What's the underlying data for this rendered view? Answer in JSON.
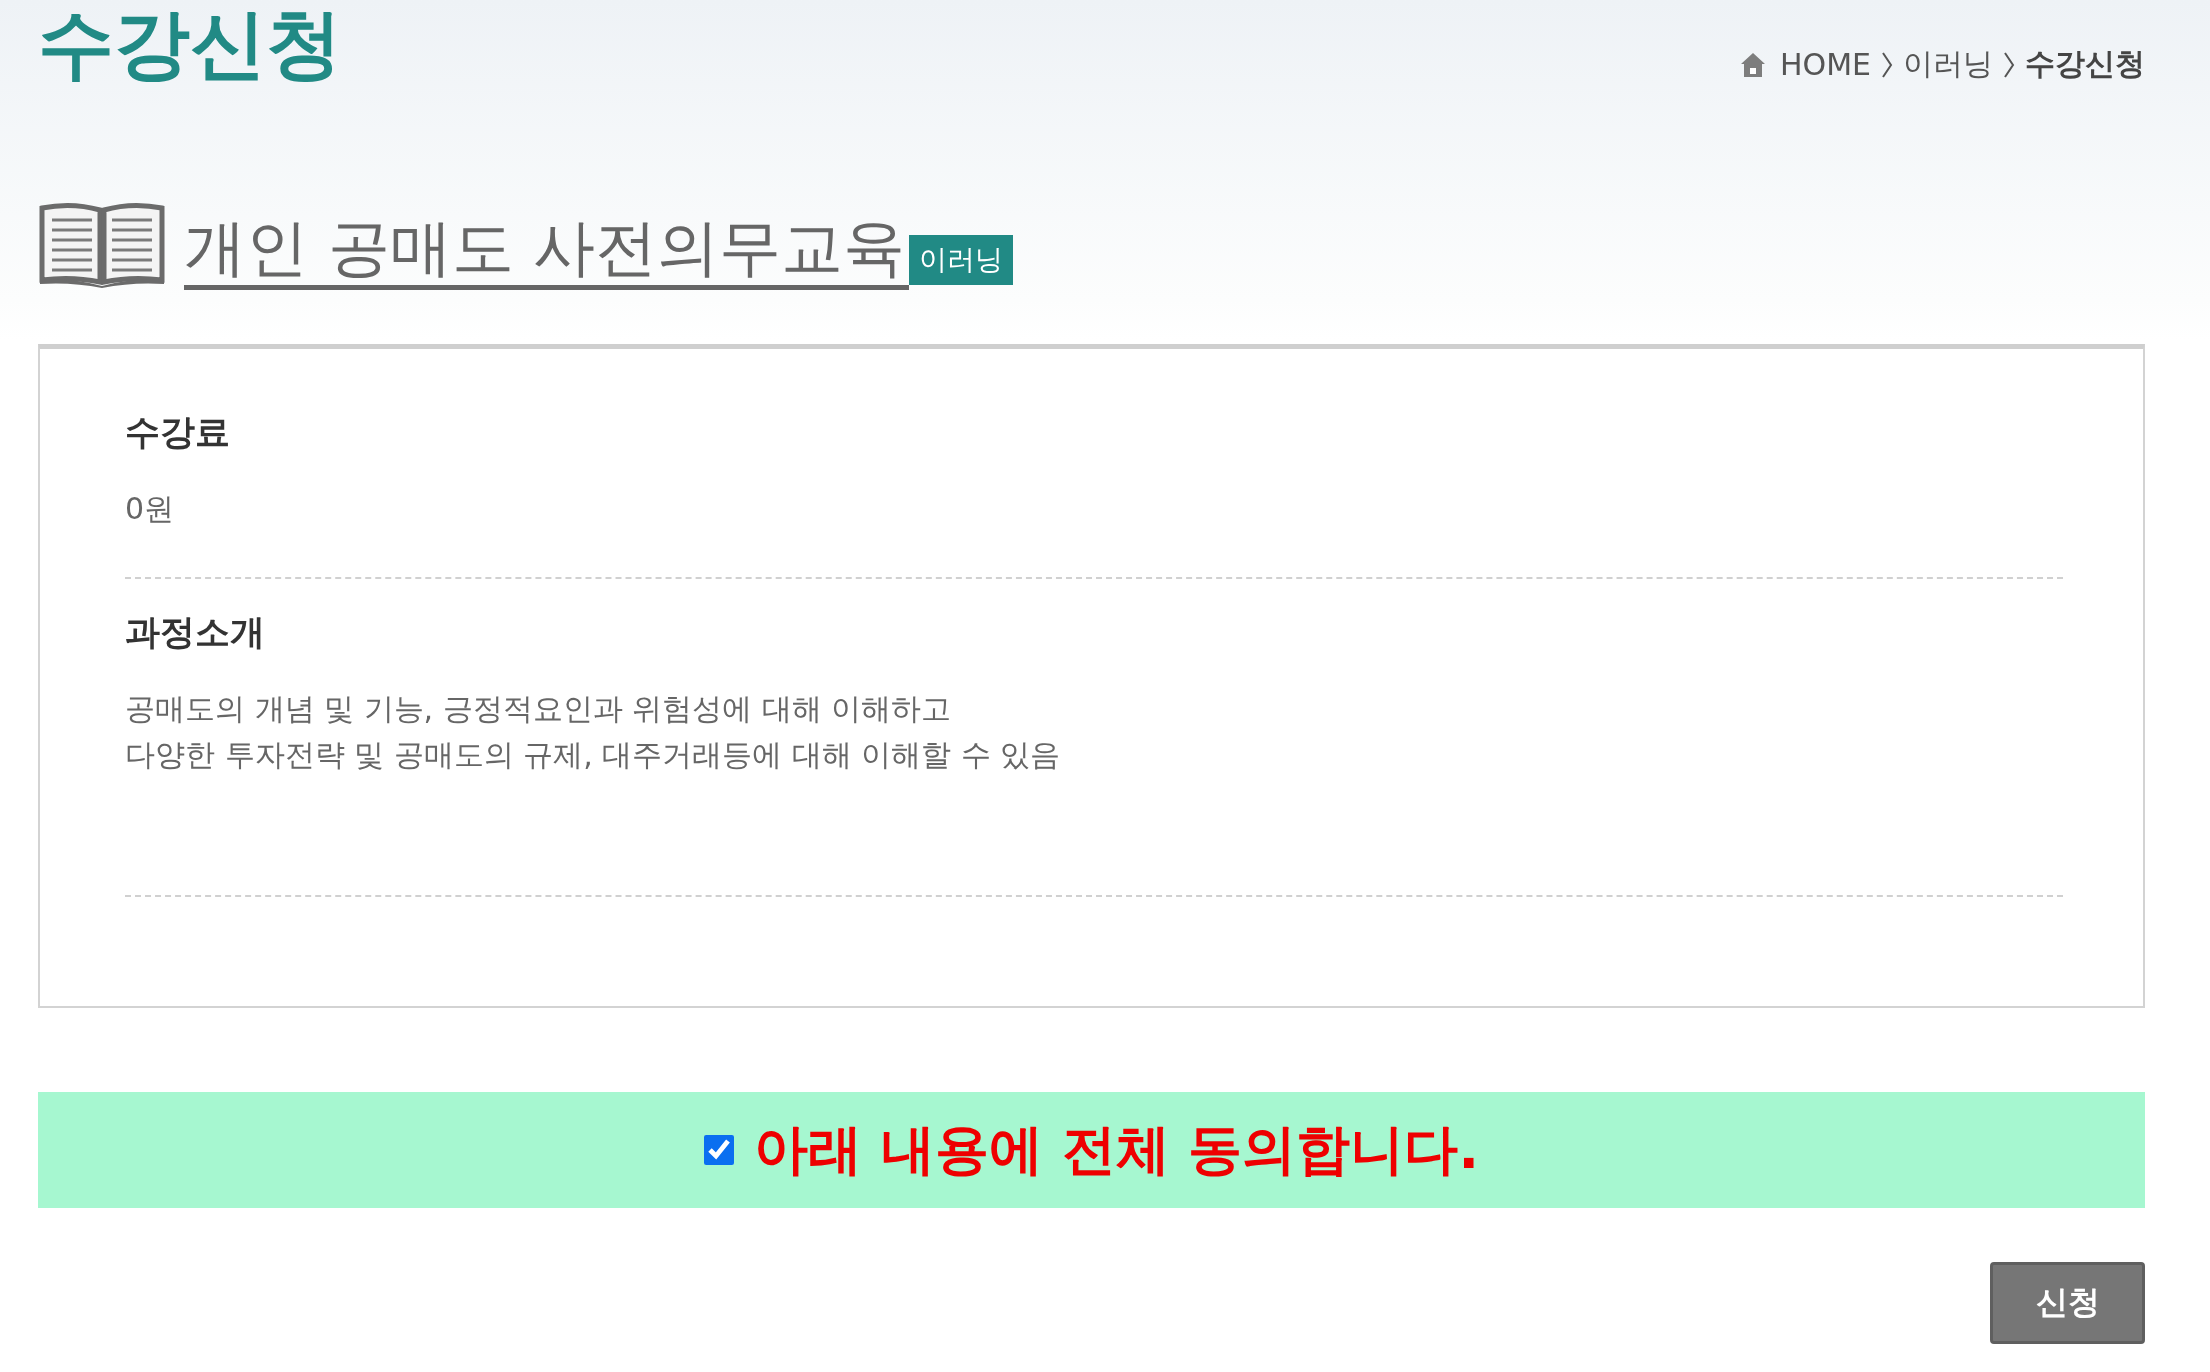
{
  "page_title": "수강신청",
  "breadcrumb": [
    {
      "label": "HOME",
      "current": false
    },
    {
      "label": "이러닝",
      "current": false
    },
    {
      "label": "수강신청",
      "current": true
    }
  ],
  "course": {
    "title": "개인 공매도 사전의무교육",
    "badge": "이러닝"
  },
  "sections": [
    {
      "heading": "수강료",
      "lines": [
        "0원"
      ]
    },
    {
      "heading": "과정소개",
      "lines": [
        "공매도의 개념 및 기능, 긍정적요인과 위험성에 대해 이해하고",
        "다양한 투자전략 및 공매도의 규제, 대주거래등에 대해 이해할 수 있음"
      ]
    }
  ],
  "agreement": {
    "label": "아래 내용에 전체 동의합니다.",
    "checked": true
  },
  "submit_button": "신청"
}
